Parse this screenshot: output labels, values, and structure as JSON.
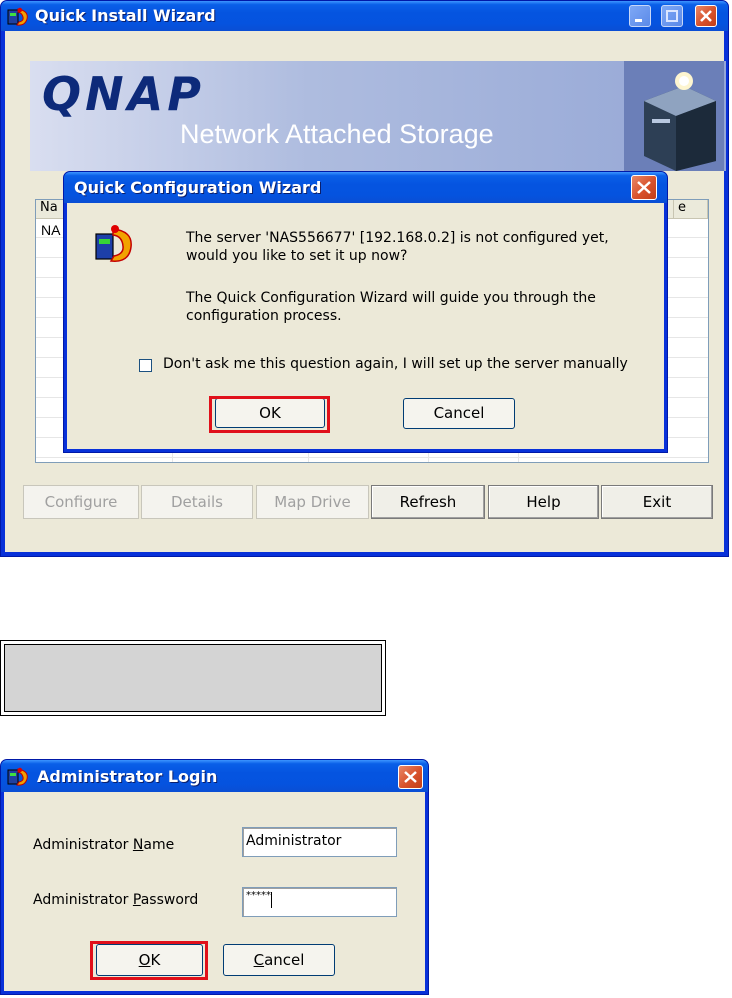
{
  "main_window": {
    "title": "Quick Install Wizard",
    "banner_brand": "QNAP",
    "banner_subtitle": "Network Attached Storage",
    "list_headers": [
      "Na",
      "e"
    ],
    "list_first_cell": "NA",
    "buttons": {
      "configure": "Configure",
      "details": "Details",
      "map_drive": "Map Drive",
      "refresh": "Refresh",
      "help": "Help",
      "exit": "Exit"
    }
  },
  "config_dialog": {
    "title": "Quick Configuration Wizard",
    "message_line1": "The server 'NAS556677' [192.168.0.2]  is not configured yet,",
    "message_line2": "would  you like to set it up now?",
    "message_line3": "The Quick Configuration Wizard will guide you through the",
    "message_line4": "configuration process.",
    "checkbox_label": "Don't ask me this question again, I will set up the server manually",
    "checkbox_checked": false,
    "ok_label": "OK",
    "cancel_label": "Cancel"
  },
  "login_dialog": {
    "title": "Administrator Login",
    "name_label_pre": "Administrator ",
    "name_label_ul": "N",
    "name_label_post": "ame",
    "password_label_pre": "Administrator ",
    "password_label_ul": "P",
    "password_label_post": "assword",
    "name_value": "Administrator",
    "password_value": "*****",
    "ok_label_ul": "O",
    "ok_label_post": "K",
    "cancel_label_ul": "C",
    "cancel_label_post": "ancel"
  },
  "colors": {
    "highlight_box": "#e0101a",
    "title_bar": "#0554e0"
  }
}
